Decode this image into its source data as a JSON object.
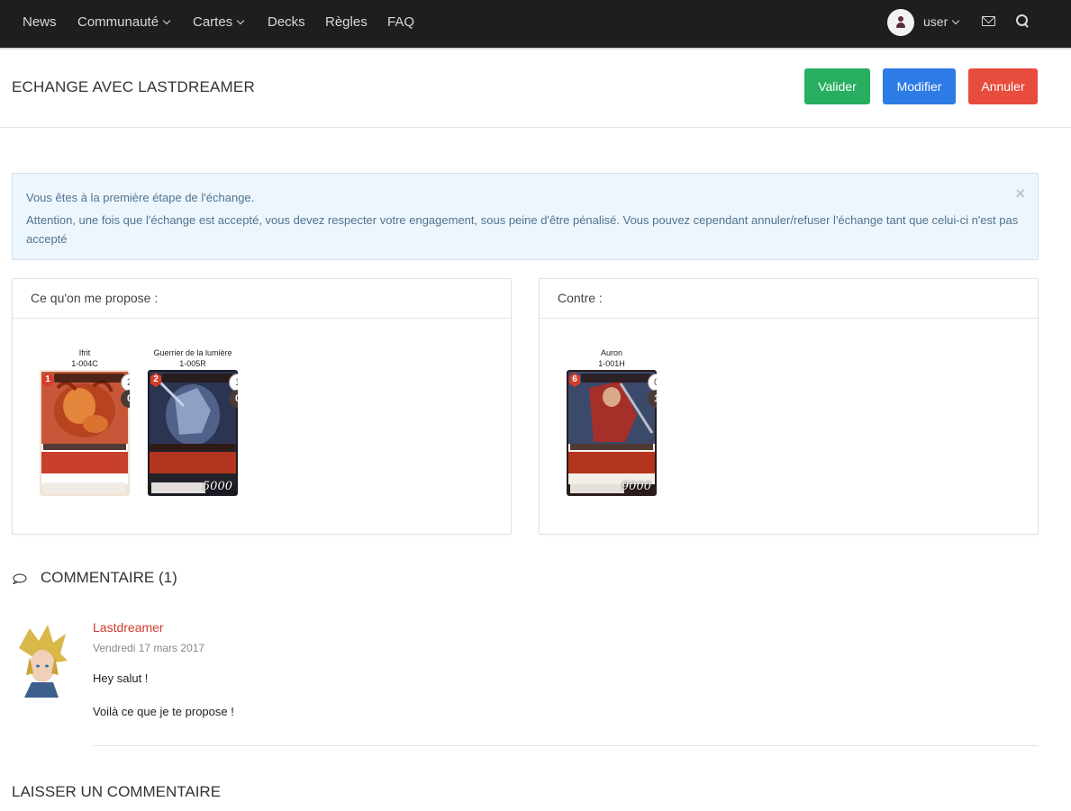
{
  "nav": {
    "items": [
      {
        "label": "News",
        "dropdown": false
      },
      {
        "label": "Communauté",
        "dropdown": true
      },
      {
        "label": "Cartes",
        "dropdown": true
      },
      {
        "label": "Decks",
        "dropdown": false
      },
      {
        "label": "Règles",
        "dropdown": false
      },
      {
        "label": "FAQ",
        "dropdown": false
      }
    ],
    "user": "user",
    "icons": [
      "user-avatar-icon",
      "envelope-icon",
      "search-icon"
    ]
  },
  "header": {
    "title": "ECHANGE AVEC LASTDREAMER",
    "buttons": {
      "valider": "Valider",
      "modifier": "Modifier",
      "annuler": "Annuler"
    },
    "colors": {
      "valider": "#27ae60",
      "modifier": "#2d7be5",
      "annuler": "#e74c3c"
    }
  },
  "alert": {
    "line1": "Vous êtes à la première étape de l'échange.",
    "line2": "Attention, une fois que l'échange est accepté, vous devez respecter votre engagement, sous peine d'être pénalisé. Vous pouvez cependant annuler/refuser l'échange tant que celui-ci n'est pas accepté",
    "close": "×"
  },
  "offer_panel": {
    "title": "Ce qu'on me propose :",
    "cards": [
      {
        "name": "Ifrit",
        "code": "1-004C",
        "cost": "1",
        "count_a": "2",
        "count_b": "0",
        "power": ""
      },
      {
        "name": "Guerrier de la lumière",
        "code": "1-005R",
        "cost": "2",
        "count_a": "1",
        "count_b": "0",
        "power": "5000"
      }
    ]
  },
  "against_panel": {
    "title": "Contre :",
    "cards": [
      {
        "name": "Auron",
        "code": "1-001H",
        "cost": "6",
        "count_a": "0",
        "count_b": "1",
        "power": "9000"
      }
    ]
  },
  "comments": {
    "heading": "COMMENTAIRE (1)",
    "items": [
      {
        "author": "Lastdreamer",
        "date": "Vendredi 17 mars 2017",
        "line1": "Hey salut !",
        "line2": "Voilà ce que je te propose !"
      }
    ],
    "leave_heading": "LAISSER UN COMMENTAIRE"
  }
}
